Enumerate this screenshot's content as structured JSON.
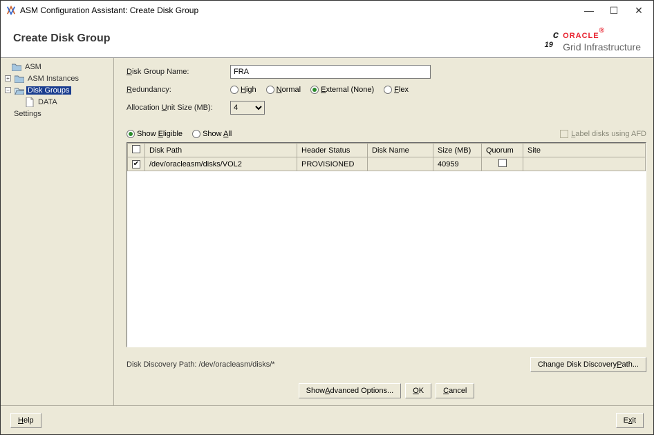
{
  "window": {
    "title": "ASM Configuration Assistant: Create Disk Group"
  },
  "header": {
    "title": "Create Disk Group"
  },
  "brand": {
    "version": "19",
    "superscript": "c",
    "name": "ORACLE",
    "reg": "®",
    "sub": "Grid Infrastructure"
  },
  "sidebar": {
    "asm": "ASM",
    "instances": "ASM Instances",
    "diskgroups": "Disk Groups",
    "data": "DATA",
    "settings": "Settings"
  },
  "form": {
    "disk_group_name_label": "Disk Group Name:",
    "disk_group_name_value": "FRA",
    "redundancy_label": "Redundancy:",
    "redundancy_options": {
      "high": "High",
      "normal": "Normal",
      "external": "External (None)",
      "flex": "Flex"
    },
    "redundancy_selected": "external",
    "alloc_label": "Allocation Unit Size (MB):",
    "alloc_value": "4",
    "show_eligible": "Show Eligible",
    "show_all": "Show All",
    "show_selected": "eligible",
    "afd_label": "Label disks using AFD",
    "columns": {
      "path": "Disk Path",
      "header": "Header Status",
      "name": "Disk Name",
      "size": "Size (MB)",
      "quorum": "Quorum",
      "site": "Site"
    },
    "rows": [
      {
        "checked": true,
        "path": "/dev/oracleasm/disks/VOL2",
        "header": "PROVISIONED",
        "name": "",
        "size": "40959",
        "quorum": false,
        "site": ""
      }
    ],
    "discovery_label": "Disk Discovery Path: /dev/oracleasm/disks/*",
    "change_path_btn": "Change Disk Discovery Path...",
    "advanced_btn": "Show Advanced Options...",
    "ok_btn": "OK",
    "cancel_btn": "Cancel"
  },
  "footer": {
    "help": "Help",
    "exit": "Exit"
  },
  "underlines": {
    "disk": "D",
    "redundancy": "R",
    "unit": "U",
    "high": "H",
    "normal": "N",
    "external": "E",
    "flex": "F",
    "eligible": "E",
    "all": "A",
    "label_disks": "L",
    "advanced": "A",
    "ok": "O",
    "cancel": "C",
    "change_path": "P",
    "help": "H",
    "exit": "x"
  }
}
